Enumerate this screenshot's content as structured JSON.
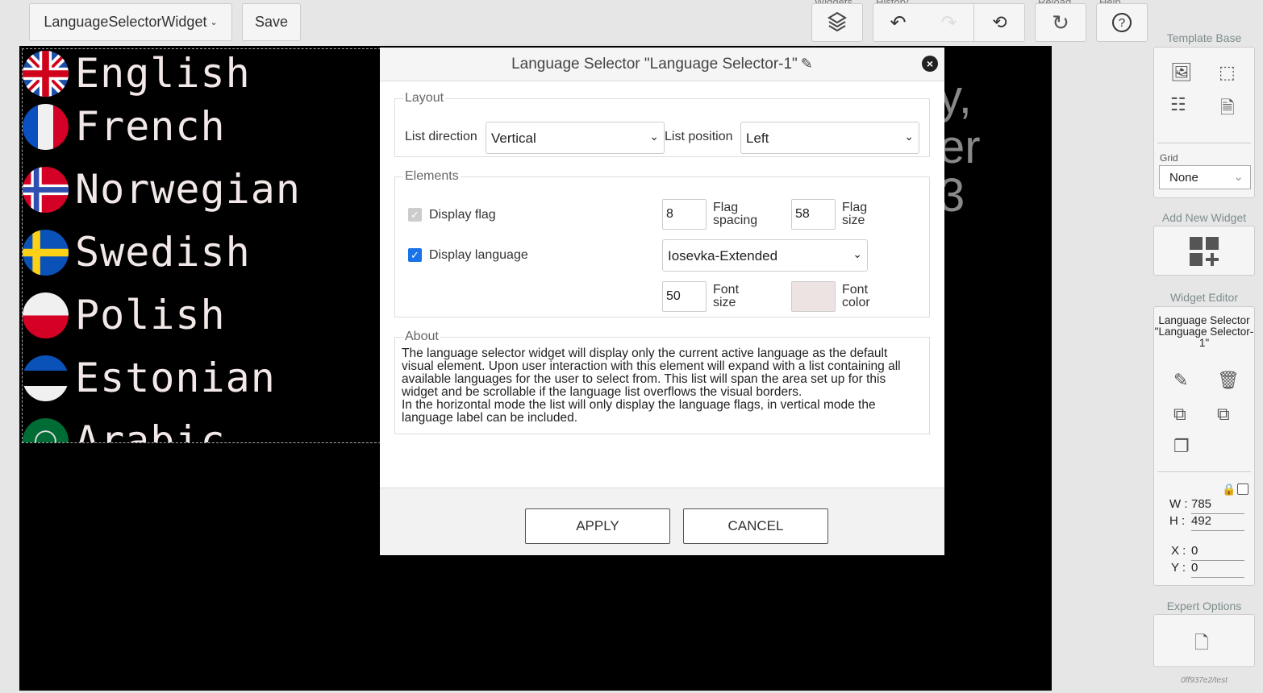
{
  "toolbar": {
    "widget_select": "LanguageSelectorWidget",
    "save": "Save",
    "groups": {
      "widgets": "Widgets",
      "history": "History",
      "reload": "Reload",
      "help": "Help"
    }
  },
  "canvas": {
    "languages": [
      {
        "name": "English",
        "flag": "uk"
      },
      {
        "name": "French",
        "flag": "fr"
      },
      {
        "name": "Norwegian",
        "flag": "no"
      },
      {
        "name": "Swedish",
        "flag": "se"
      },
      {
        "name": "Polish",
        "flag": "pl"
      },
      {
        "name": "Estonian",
        "flag": "ee"
      },
      {
        "name": "Arabic",
        "flag": "arab-league"
      }
    ],
    "background_text": [
      "y,",
      "er",
      "3"
    ]
  },
  "dialog": {
    "title": "Language Selector \"Language Selector-1\"",
    "layout": {
      "legend": "Layout",
      "list_direction_label": "List direction",
      "list_direction": "Vertical",
      "list_position_label": "List position",
      "list_position": "Left"
    },
    "elements": {
      "legend": "Elements",
      "display_flag": "Display flag",
      "display_flag_checked": true,
      "display_language": "Display language",
      "display_language_checked": true,
      "flag_spacing": "8",
      "flag_spacing_label_1": "Flag",
      "flag_spacing_label_2": "spacing",
      "flag_size": "58",
      "flag_size_label_1": "Flag",
      "flag_size_label_2": "size",
      "font": "Iosevka-Extended",
      "font_size": "50",
      "font_size_label_1": "Font",
      "font_size_label_2": "size",
      "font_color_label_1": "Font",
      "font_color_label_2": "color",
      "font_color": "#ede3e3"
    },
    "about": {
      "legend": "About",
      "text1": "The language selector widget will display only the current active language as the default visual element. Upon user interaction with this element will expand with a list containing all available languages for the user to select from. This list will span the area set up for this widget and be scrollable if the language list overflows the visual borders.",
      "text2": "In the horizontal mode the list will only display the language flags, in vertical mode the language label can be included."
    },
    "apply": "APPLY",
    "cancel": "CANCEL"
  },
  "sidebar": {
    "template_base": "Template Base",
    "grid_label": "Grid",
    "grid": "None",
    "add_new_widget": "Add New Widget",
    "widget_editor": "Widget Editor",
    "widget_name": "Language Selector \"Language Selector-1\"",
    "w_label": "W :",
    "w": "785",
    "h_label": "H :",
    "h": "492",
    "x_label": "X :",
    "x": "0",
    "y_label": "Y :",
    "y": "0",
    "lock_checked": false,
    "expert_options": "Expert Options",
    "footer": "0ff937e2/test"
  },
  "colors": {
    "accent": "#1a73e8",
    "canvas": "#000000",
    "text": "#f2e8e8"
  }
}
